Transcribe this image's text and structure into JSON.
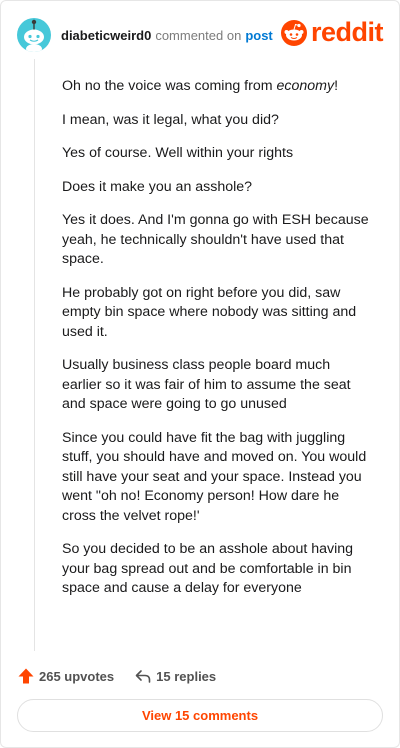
{
  "header": {
    "username": "diabeticweird0",
    "commented_on": "commented on",
    "post_link": "post",
    "logo_text": "reddit"
  },
  "comment": {
    "paragraphs": [
      {
        "pre": "Oh no the voice was coming from ",
        "em": "economy",
        "post": "!"
      },
      "I mean, was it legal, what you did?",
      "Yes of course. Well within your rights",
      "Does it make you an asshole?",
      "Yes it does. And I'm gonna go with ESH because yeah, he technically shouldn't have used that space.",
      "He probably got on right before you did, saw empty bin space where nobody was sitting and used it.",
      "Usually business class people board much earlier so it was fair of him to assume the seat and space were going to go unused",
      "Since you could have fit the bag with juggling stuff, you should have and moved on. You would still have your seat and your space. Instead you went \"oh no! Economy person! How dare he cross the velvet rope!'",
      "So you decided to be an asshole about having your bag spread out and be comfortable in bin space and cause a delay for everyone"
    ]
  },
  "actions": {
    "upvotes": "265 upvotes",
    "replies": "15 replies"
  },
  "view_button": "View 15 comments",
  "colors": {
    "accent": "#ff4500",
    "link": "#0079d3",
    "avatar": "#46c8d9"
  }
}
